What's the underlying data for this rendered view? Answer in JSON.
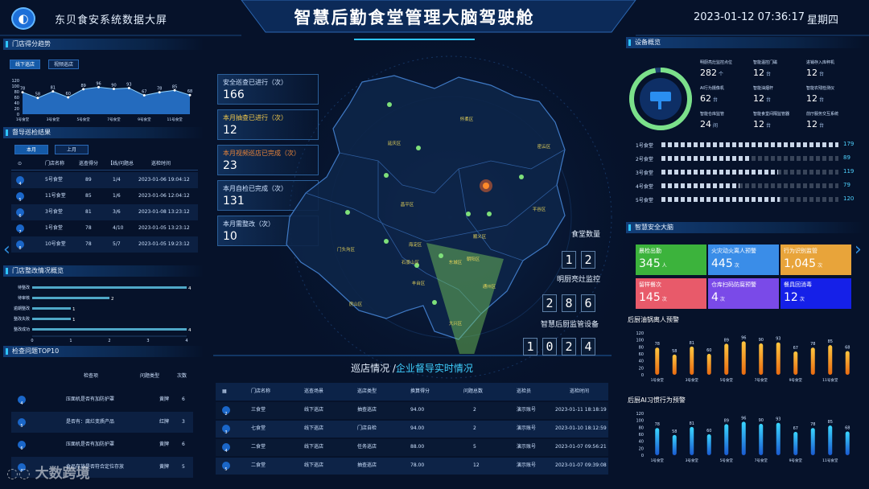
{
  "header": {
    "system_name": "东贝食安系统数据大屏",
    "title": "智慧后勤食堂管理大脑驾驶舱",
    "datetime": "2023-01-12 07:36:17",
    "weekday": "星期四"
  },
  "colors": {
    "background": "#06122a",
    "accent": "#2ec5ff",
    "yellow": "#f2c94c",
    "orange": "#e8843a"
  },
  "store_trend": {
    "title": "门店得分趋势",
    "tabs": [
      "线下巡店",
      "视频巡店"
    ],
    "active_tab": 0,
    "chart_data": {
      "type": "area",
      "categories": [
        "1号食堂",
        "",
        "3号食堂",
        "",
        "5号食堂",
        "",
        "7号食堂",
        "",
        "9号食堂",
        "",
        "11号食堂",
        ""
      ],
      "values": [
        78,
        58,
        81,
        60,
        89,
        96,
        90,
        93,
        67,
        78,
        85,
        68
      ],
      "y_ticks": [
        "120",
        "100",
        "80",
        "60",
        "40",
        "20",
        "0"
      ],
      "ylim": [
        0,
        120
      ]
    }
  },
  "inspection_results": {
    "title": "督导巡检结果",
    "tabs": [
      "本月",
      "上月"
    ],
    "active_tab": 0,
    "columns": [
      "",
      "门店名称",
      "巡查得分",
      "【线/问题总",
      "巡检时间"
    ],
    "rows": [
      {
        "idx": "4",
        "name": "5号食堂",
        "score": "89",
        "ratio": "1/4",
        "time": "2023-01-06 19:04:12"
      },
      {
        "idx": "5",
        "name": "11号食堂",
        "score": "85",
        "ratio": "1/6",
        "time": "2023-01-06 12:04:12"
      },
      {
        "idx": "6",
        "name": "3号食堂",
        "score": "81",
        "ratio": "3/6",
        "time": "2023-01-08 13:23:12"
      },
      {
        "idx": "7",
        "name": "1号食堂",
        "score": "78",
        "ratio": "4/10",
        "time": "2023-01-05 13:23:12"
      },
      {
        "idx": "8",
        "name": "10号食堂",
        "score": "78",
        "ratio": "5/7",
        "time": "2023-01-05 19:23:12"
      }
    ]
  },
  "rectification": {
    "title": "门店整改情况概览",
    "chart_data": {
      "type": "bar",
      "categories": [
        "待整改",
        "待审核",
        "逾期整改",
        "整改失败",
        "整改成功"
      ],
      "values": [
        4,
        2,
        1,
        1,
        4
      ],
      "x_ticks": [
        "0",
        "1",
        "2",
        "3",
        "4"
      ],
      "xlim": [
        0,
        4
      ]
    }
  },
  "top10": {
    "title": "检查问题TOP10",
    "columns": [
      "",
      "检查项",
      "问题类型",
      "次数"
    ],
    "rows": [
      {
        "idx": "4",
        "item": "压面机是否有加防护罩",
        "type": "黄牌",
        "count": "6"
      },
      {
        "idx": "5",
        "item": "是否有：腐烂变质产品",
        "type": "红牌",
        "count": "3"
      },
      {
        "idx": "6",
        "item": "压面机是否有加防护罩",
        "type": "黄牌",
        "count": "6"
      },
      {
        "idx": "7",
        "item": "食品存放是否符合定位存放",
        "type": "黄牌",
        "count": "5"
      }
    ]
  },
  "stats": [
    {
      "label": "安全巡查已进行（次）",
      "value": "166",
      "color": "#cfe3ff"
    },
    {
      "label": "本月抽查已进行（次）",
      "value": "12",
      "color": "#f2c94c"
    },
    {
      "label": "本月视频巡店已完成（次）",
      "value": "23",
      "color": "#e8843a"
    },
    {
      "label": "本月自检已完成（次）",
      "value": "131",
      "color": "#cfe3ff"
    },
    {
      "label": "本月需整改（次）",
      "value": "10",
      "color": "#cfe3ff"
    }
  ],
  "map": {
    "districts": [
      "怀柔区",
      "延庆区",
      "密云区",
      "平谷区",
      "昌平区",
      "顺义区",
      "海淀区",
      "朝阳区",
      "门头沟区",
      "石景山区",
      "东城区",
      "丰台区",
      "通州区",
      "房山区",
      "大兴区"
    ]
  },
  "counters": [
    {
      "label": "食堂数量",
      "digits": [
        "1",
        "2"
      ]
    },
    {
      "label": "明厨亮灶监控",
      "digits": [
        "2",
        "8",
        "6"
      ]
    },
    {
      "label": "智慧后厨监管设备",
      "digits": [
        "1",
        "0",
        "2",
        "4"
      ]
    }
  ],
  "patrol_table": {
    "title_a": "巡店情况 /",
    "title_b": "企业督导实时情况",
    "columns": [
      "",
      "门店名称",
      "巡查场景",
      "巡店类型",
      "换算得分",
      "问题总数",
      "巡检员",
      "巡检时间"
    ],
    "rows": [
      {
        "idx": "2",
        "name": "三食堂",
        "scene": "线下巡店",
        "type": "抽查巡店",
        "score": "94.00",
        "issues": "2",
        "inspector": "演示账号",
        "time": "2023-01-11 18:18:19"
      },
      {
        "idx": "3",
        "name": "七食堂",
        "scene": "线下巡店",
        "type": "门店自检",
        "score": "94.00",
        "issues": "2",
        "inspector": "演示账号",
        "time": "2023-01-10 18:12:59"
      },
      {
        "idx": "4",
        "name": "二食堂",
        "scene": "线下巡店",
        "type": "任务巡店",
        "score": "88.00",
        "issues": "5",
        "inspector": "演示账号",
        "time": "2023-01-07 09:56:21"
      },
      {
        "idx": "5",
        "name": "二食堂",
        "scene": "线下巡店",
        "type": "抽查巡店",
        "score": "78.00",
        "issues": "12",
        "inspector": "演示账号",
        "time": "2023-01-07 09:39:08"
      }
    ]
  },
  "devices": {
    "title": "设备概览",
    "gauge": {
      "online_fraction": 0.97
    },
    "items": [
      {
        "name": "明厨亮灶监控点位",
        "value": "282",
        "unit": "个"
      },
      {
        "name": "智能温控门磁",
        "value": "12",
        "unit": "台"
      },
      {
        "name": "进销存入库秤机",
        "value": "12",
        "unit": "台"
      },
      {
        "name": "AI行为摄像机",
        "value": "62",
        "unit": "台"
      },
      {
        "name": "智能油烟杆",
        "value": "12",
        "unit": "台"
      },
      {
        "name": "智能农残检测仪",
        "value": "12",
        "unit": "台"
      },
      {
        "name": "智能仓库监管",
        "value": "24",
        "unit": "间"
      },
      {
        "name": "智能食堂间隔监管器",
        "value": "12",
        "unit": "台"
      },
      {
        "name": "前厅服务交互系统",
        "value": "12",
        "unit": "台"
      }
    ],
    "bars": [
      {
        "label": "1号食堂",
        "value": "179",
        "fraction": 1.0
      },
      {
        "label": "2号食堂",
        "value": "89",
        "fraction": 0.5
      },
      {
        "label": "3号食堂",
        "value": "119",
        "fraction": 0.66
      },
      {
        "label": "4号食堂",
        "value": "79",
        "fraction": 0.44
      },
      {
        "label": "5号食堂",
        "value": "120",
        "fraction": 0.67
      }
    ]
  },
  "brain": {
    "title": "智慧安全大脑",
    "cards": [
      {
        "label": "晨检出勤",
        "value": "345",
        "unit": "人",
        "color": "#3cb33c"
      },
      {
        "label": "火灾动火离人预警",
        "value": "445",
        "unit": "次",
        "color": "#3a8de8"
      },
      {
        "label": "行为识别监管",
        "value": "1,045",
        "unit": "次",
        "color": "#e8a43a"
      },
      {
        "label": "留样餐次",
        "value": "145",
        "unit": "次",
        "color": "#e85a6a"
      },
      {
        "label": "仓库扫码防腐预警",
        "value": "4",
        "unit": "次",
        "color": "#7a4ae8"
      },
      {
        "label": "餐具回消毒",
        "value": "12",
        "unit": "次",
        "color": "#1520e8"
      }
    ]
  },
  "oil_alert": {
    "title": "后厨油锅离人预警",
    "chart_data": {
      "type": "bar",
      "categories": [
        "1号食堂",
        "",
        "3号食堂",
        "",
        "5号食堂",
        "",
        "7号食堂",
        "",
        "9号食堂",
        "",
        "11号食堂",
        ""
      ],
      "values": [
        78,
        58,
        81,
        60,
        89,
        96,
        90,
        93,
        67,
        78,
        85,
        68
      ],
      "y_ticks": [
        "120",
        "100",
        "80",
        "60",
        "40",
        "20",
        "0"
      ],
      "ylim": [
        0,
        120
      ]
    }
  },
  "ai_alert": {
    "title": "后厨AI习惯行为预警",
    "chart_data": {
      "type": "bar",
      "categories": [
        "1号食堂",
        "",
        "3号食堂",
        "",
        "5号食堂",
        "",
        "7号食堂",
        "",
        "9号食堂",
        "",
        "11号食堂",
        ""
      ],
      "values": [
        78,
        58,
        81,
        60,
        89,
        96,
        90,
        93,
        67,
        78,
        85,
        68
      ],
      "y_ticks": [
        "120",
        "100",
        "80",
        "60",
        "40",
        "20",
        "0"
      ],
      "ylim": [
        0,
        120
      ]
    }
  },
  "watermark": {
    "text": "大数跨境"
  }
}
